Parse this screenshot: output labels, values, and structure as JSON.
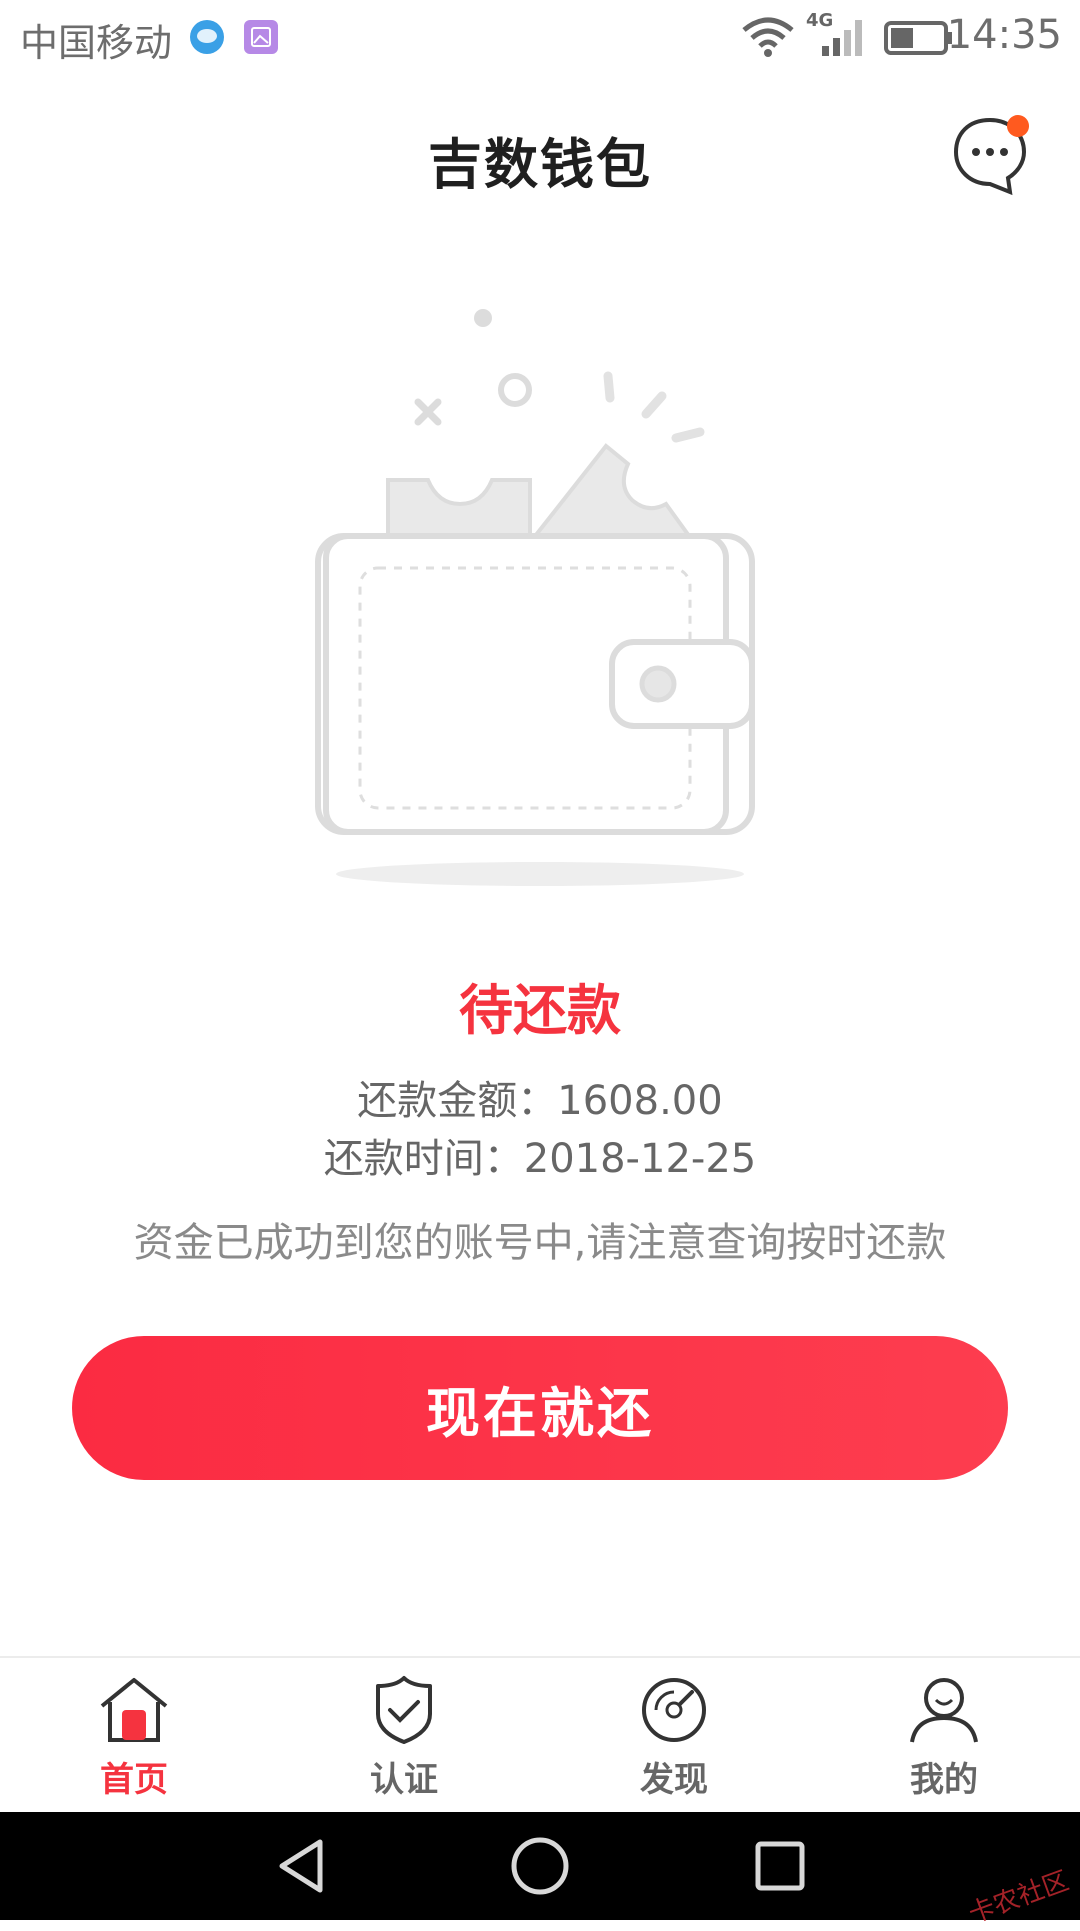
{
  "status_bar": {
    "carrier": "中国移动",
    "network": "4G",
    "time": "14:35"
  },
  "header": {
    "title": "吉数钱包",
    "message_icon": "chat-bubble-icon",
    "has_notification_dot": true
  },
  "loan": {
    "status": "待还款",
    "amount_line": "还款金额：1608.00",
    "date_line": "还款时间：2018-12-25",
    "notice": "资金已成功到您的账号中,请注意查询按时还款",
    "button_label": "现在就还"
  },
  "tabs": [
    {
      "label": "首页",
      "icon": "home-icon",
      "active": true
    },
    {
      "label": "认证",
      "icon": "shield-check-icon",
      "active": false
    },
    {
      "label": "发现",
      "icon": "compass-icon",
      "active": false
    },
    {
      "label": "我的",
      "icon": "user-icon",
      "active": false
    }
  ],
  "watermark": "卡农社区",
  "colors": {
    "accent": "#f5333f",
    "text_gray": "#666666"
  }
}
